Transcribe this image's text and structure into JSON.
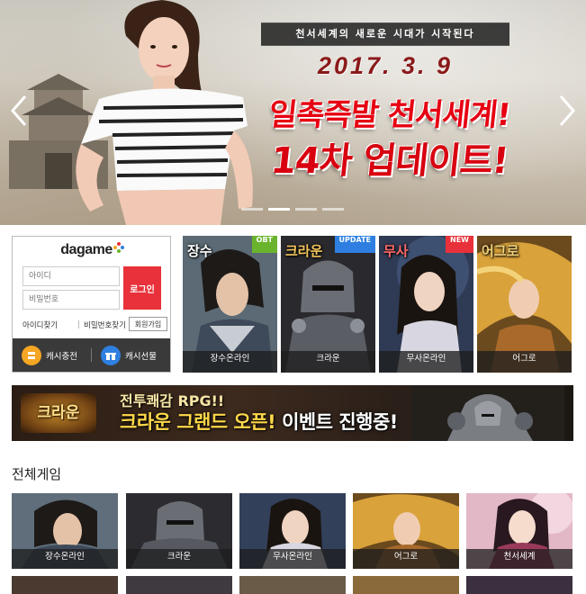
{
  "hero": {
    "tagline": "천서세계의 새로운 시대가 시작된다",
    "date": "2017. 3. 9",
    "title_line1": "일촉즉발 천서세계!",
    "title_line2": "14차 업데이트!",
    "slide_count": 4,
    "active_slide": 2
  },
  "login": {
    "logo_text": "dagame",
    "id_placeholder": "아이디",
    "pw_placeholder": "비밀번호",
    "login_button": "로그인",
    "find_id": "아이디찾기",
    "find_pw": "비밀번호찾기",
    "join": "회원가입",
    "cash_charge": "캐시충전",
    "cash_gift": "캐시선물"
  },
  "featured_games": [
    {
      "name": "장수온라인",
      "title_art": "장수",
      "badge": "OBT",
      "badge_color": "#6ab42d"
    },
    {
      "name": "크라운",
      "title_art": "크라운",
      "badge": "UPDATE",
      "badge_color": "#2f7fe0"
    },
    {
      "name": "무사온라인",
      "title_art": "무사",
      "badge": "NEW",
      "badge_color": "#e8313a"
    },
    {
      "name": "어그로",
      "title_art": "어그로",
      "badge": "",
      "badge_color": ""
    }
  ],
  "banner": {
    "logo": "크라운",
    "subtitle": "전투쾌감 RPG!!",
    "main_yellow": "크라운 그랜드 오픈!",
    "main_white": "이벤트 진행중!"
  },
  "all_games": {
    "title": "전체게임",
    "items": [
      "장수온라인",
      "크라운",
      "무사온라인",
      "어그로",
      "천서세계"
    ]
  },
  "colors": {
    "accent_red": "#e8313a",
    "dark_bar": "#3a3a3a",
    "hero_title": "#e60012"
  }
}
